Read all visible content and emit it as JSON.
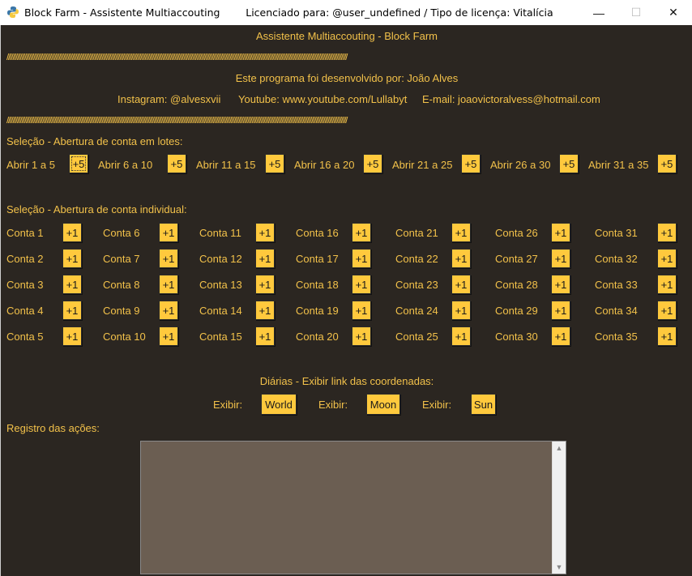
{
  "window": {
    "title": "Block Farm - Assistente Multiaccouting        Licenciado para: @user_undefined / Tipo de licença: Vitalícia",
    "icon": "python-icon",
    "controls": {
      "minimize": "—",
      "maximize": "☐",
      "close": "✕"
    }
  },
  "header": {
    "title": "Assistente Multiaccouting - Block Farm",
    "separator": "/////////////////////////////////////////////////////////////////////////////////////////////////////////////////////////////////////////////////////////////////////////////////////////////////////////////////////////////////////",
    "dev_line": "Este programa foi desenvolvido por: João Alves",
    "contacts": {
      "instagram": "Instagram: @alvesxvii",
      "youtube": "Youtube: www.youtube.com/Lullabyt",
      "email": "E-mail: joaovictoralvess@hotmail.com"
    }
  },
  "batch": {
    "heading": "Seleção - Abertura de conta em lotes:",
    "items": [
      {
        "label": "Abrir 1 a 5",
        "button": "+5"
      },
      {
        "label": "Abrir 6 a 10",
        "button": "+5"
      },
      {
        "label": "Abrir 11 a 15",
        "button": "+5"
      },
      {
        "label": "Abrir 16 a 20",
        "button": "+5"
      },
      {
        "label": "Abrir 21 a 25",
        "button": "+5"
      },
      {
        "label": "Abrir 26 a 30",
        "button": "+5"
      },
      {
        "label": "Abrir 31 a 35",
        "button": "+5"
      }
    ]
  },
  "individual": {
    "heading": "Seleção - Abertura de conta individual:",
    "button": "+1",
    "accounts": [
      "Conta 1",
      "Conta 2",
      "Conta 3",
      "Conta 4",
      "Conta 5",
      "Conta 6",
      "Conta 7",
      "Conta 8",
      "Conta 9",
      "Conta 10",
      "Conta 11",
      "Conta 12",
      "Conta 13",
      "Conta 14",
      "Conta 15",
      "Conta 16",
      "Conta 17",
      "Conta 18",
      "Conta 19",
      "Conta 20",
      "Conta 21",
      "Conta 22",
      "Conta 23",
      "Conta 24",
      "Conta 25",
      "Conta 26",
      "Conta 27",
      "Conta 28",
      "Conta 29",
      "Conta 30",
      "Conta 31",
      "Conta 32",
      "Conta 33",
      "Conta 34",
      "Conta 35"
    ]
  },
  "daily": {
    "heading": "Diárias - Exibir link das coordenadas:",
    "items": [
      {
        "label": "Exibir:",
        "button": "World"
      },
      {
        "label": "Exibir:",
        "button": "Moon"
      },
      {
        "label": "Exibir:",
        "button": "Sun"
      }
    ]
  },
  "log": {
    "heading": "Registro das ações:",
    "content": ""
  },
  "colors": {
    "background": "#2b2621",
    "text": "#f2c14a",
    "button": "#ffc93d",
    "log_bg": "#6b5e52"
  }
}
